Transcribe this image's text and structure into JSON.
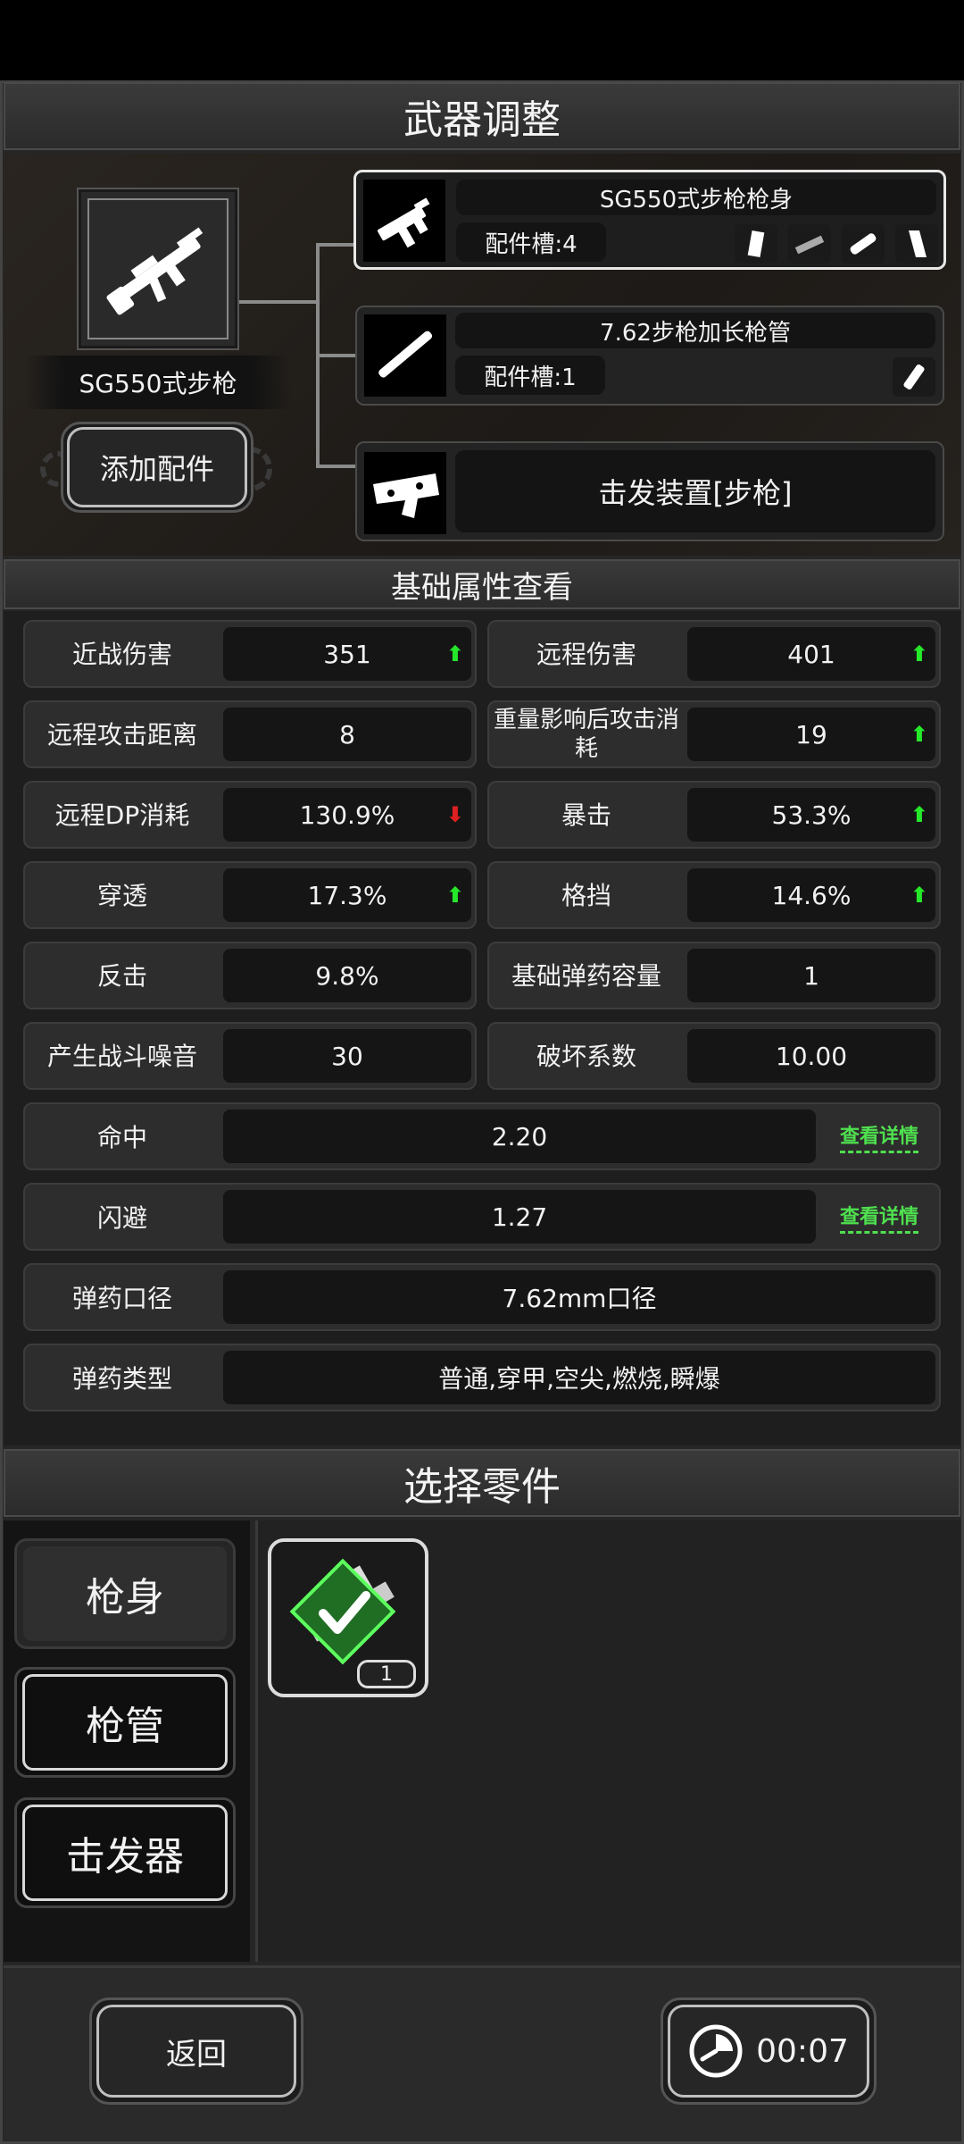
{
  "header": {
    "title": "武器调整"
  },
  "weapon": {
    "name": "SG550式步枪",
    "add_parts_label": "添加配件"
  },
  "parts": [
    {
      "name": "SG550式步枪枪身",
      "slots_label": "配件槽:4"
    },
    {
      "name": "7.62步枪加长枪管",
      "slots_label": "配件槽:1"
    },
    {
      "name": "击发装置[步枪]"
    }
  ],
  "stats": {
    "title": "基础属性查看",
    "rows": [
      {
        "left_label": "近战伤害",
        "left_value": "351",
        "left_arrow": "up",
        "right_label": "远程伤害",
        "right_value": "401",
        "right_arrow": "up"
      },
      {
        "left_label": "远程攻击距离",
        "left_value": "8",
        "left_arrow": "",
        "right_label": "重量影响后攻击消耗",
        "right_value": "19",
        "right_arrow": "up"
      },
      {
        "left_label": "远程DP消耗",
        "left_value": "130.9%",
        "left_arrow": "down",
        "right_label": "暴击",
        "right_value": "53.3%",
        "right_arrow": "up"
      },
      {
        "left_label": "穿透",
        "left_value": "17.3%",
        "left_arrow": "up",
        "right_label": "格挡",
        "right_value": "14.6%",
        "right_arrow": "up"
      },
      {
        "left_label": "反击",
        "left_value": "9.8%",
        "left_arrow": "",
        "right_label": "基础弹药容量",
        "right_value": "1",
        "right_arrow": ""
      },
      {
        "left_label": "产生战斗噪音",
        "left_value": "30",
        "left_arrow": "",
        "right_label": "破坏系数",
        "right_value": "10.00",
        "right_arrow": ""
      }
    ],
    "wide_rows": [
      {
        "label": "命中",
        "value": "2.20",
        "link": "查看详情"
      },
      {
        "label": "闪避",
        "value": "1.27",
        "link": "查看详情"
      },
      {
        "label": "弹药口径",
        "value": "7.62mm口径",
        "link": ""
      },
      {
        "label": "弹药类型",
        "value": "普通,穿甲,空尖,燃烧,瞬爆",
        "link": ""
      }
    ]
  },
  "select": {
    "title": "选择零件",
    "tabs": [
      {
        "label": "枪身"
      },
      {
        "label": "枪管"
      },
      {
        "label": "击发器"
      }
    ],
    "item_count": "1"
  },
  "footer": {
    "back_label": "返回",
    "timer": "00:07"
  }
}
